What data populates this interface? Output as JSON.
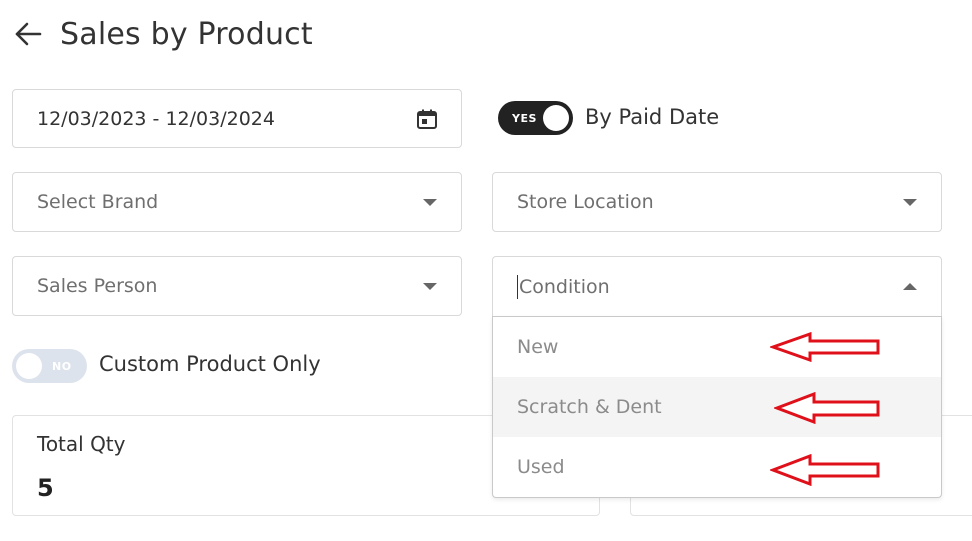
{
  "header": {
    "title": "Sales by Product",
    "back_icon": "arrow-left-icon"
  },
  "filters": {
    "date_range": {
      "value": "12/03/2023 - 12/03/2024",
      "icon": "calendar-icon"
    },
    "paid_date_toggle": {
      "state": "YES",
      "label": "By Paid Date",
      "on": true
    },
    "brand": {
      "placeholder": "Select Brand"
    },
    "store_location": {
      "placeholder": "Store Location"
    },
    "sales_person": {
      "placeholder": "Sales Person"
    },
    "condition": {
      "placeholder": "Condition",
      "open": true
    },
    "custom_product_toggle": {
      "state": "NO",
      "label": "Custom Product Only",
      "on": false
    }
  },
  "condition_options": [
    {
      "label": "New",
      "highlighted": false
    },
    {
      "label": "Scratch & Dent",
      "highlighted": true
    },
    {
      "label": "Used",
      "highlighted": false
    }
  ],
  "summary": {
    "total_qty": {
      "label": "Total Qty",
      "value": "5"
    }
  },
  "colors": {
    "annotation_arrow": "#e0101a",
    "toggle_on": "#222222",
    "toggle_off": "#dde3ec"
  }
}
